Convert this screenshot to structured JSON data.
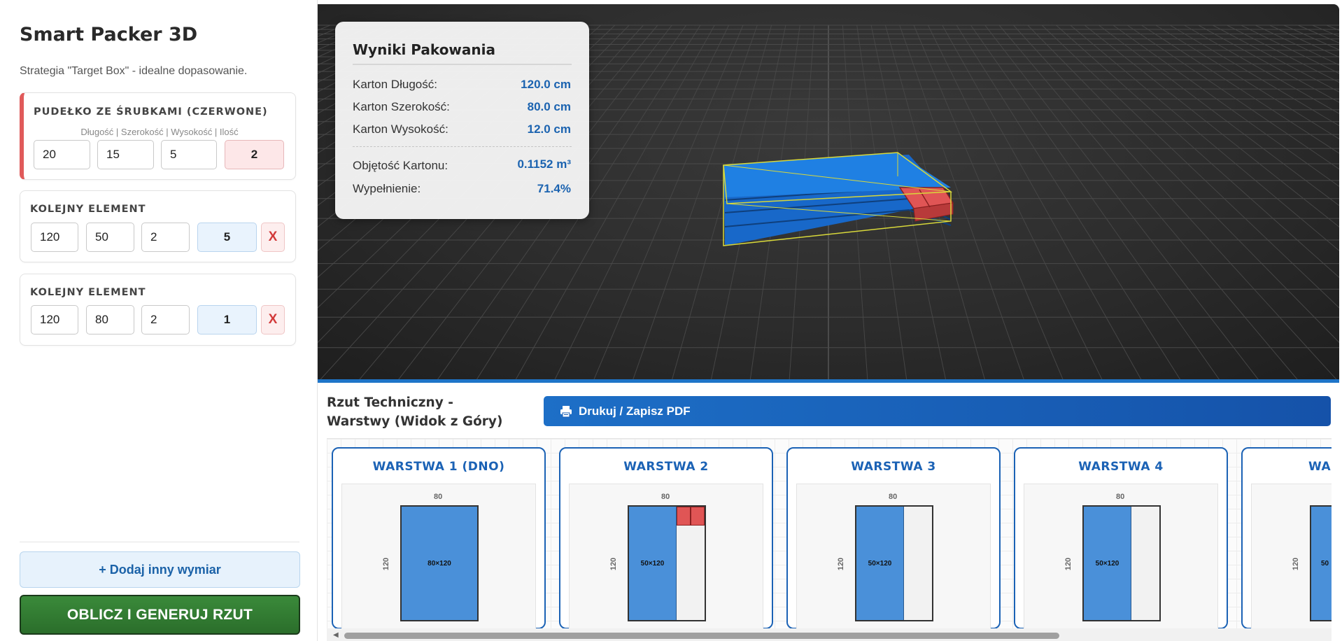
{
  "app": {
    "title": "Smart Packer 3D",
    "subtitle": "Strategia \"Target Box\" - idealne dopasowanie."
  },
  "main_box": {
    "title": "PUDEŁKO ZE ŚRUBKAMI (CZERWONE)",
    "hint": "Długość | Szerokość | Wysokość | Ilość",
    "length": "20",
    "width": "15",
    "height": "5",
    "qty": "2"
  },
  "items": [
    {
      "title": "KOLEJNY ELEMENT",
      "length": "120",
      "width": "50",
      "height": "2",
      "qty": "5",
      "delete_label": "X"
    },
    {
      "title": "KOLEJNY ELEMENT",
      "length": "120",
      "width": "80",
      "height": "2",
      "qty": "1",
      "delete_label": "X"
    }
  ],
  "actions": {
    "add_label": "+ Dodaj inny wymiar",
    "calc_label": "OBLICZ I GENERUJ RZUT",
    "pdf_label": "Drukuj / Zapisz PDF"
  },
  "results": {
    "title": "Wyniki Pakowania",
    "rows": [
      {
        "label": "Karton Długość:",
        "value": "120.0 cm"
      },
      {
        "label": "Karton Szerokość:",
        "value": "80.0 cm"
      },
      {
        "label": "Karton Wysokość:",
        "value": "12.0 cm"
      },
      {
        "label": "Objętość Kartonu:",
        "value": "0.1152 m³"
      },
      {
        "label": "Wypełnienie:",
        "value": "71.4%"
      }
    ]
  },
  "tech": {
    "title": "Rzut Techniczny - Warstwy (Widok z Góry)",
    "layers": [
      {
        "title": "WARSTWA 1 (DNO)",
        "top_dim": "80",
        "left_dim": "120",
        "box_label": "80×120"
      },
      {
        "title": "WARSTWA 2",
        "top_dim": "80",
        "left_dim": "120",
        "box_label": "50×120"
      },
      {
        "title": "WARSTWA 3",
        "top_dim": "80",
        "left_dim": "120",
        "box_label": "50×120"
      },
      {
        "title": "WARSTWA 4",
        "top_dim": "80",
        "left_dim": "120",
        "box_label": "50×120"
      },
      {
        "title": "WA",
        "left_dim": "120",
        "box_label": "50"
      }
    ]
  },
  "colors": {
    "accent_blue": "#1b62b5",
    "box_red": "#e05555",
    "box_blue": "#4a90d9",
    "calc_green": "#2b6e2b"
  }
}
